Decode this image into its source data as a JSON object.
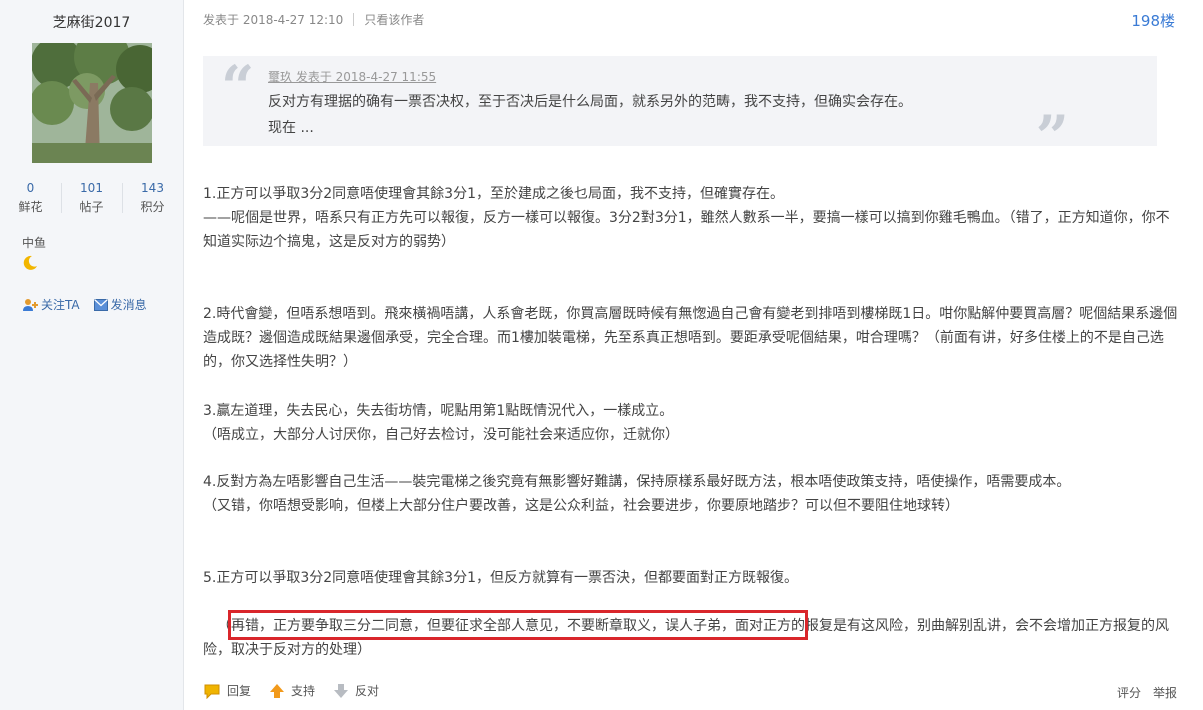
{
  "user": {
    "name": "芝麻街2017",
    "stats": [
      {
        "value": "0",
        "label": "鲜花"
      },
      {
        "value": "101",
        "label": "帖子"
      },
      {
        "value": "143",
        "label": "积分"
      }
    ],
    "rank": "中鱼",
    "follow_label": "关注TA",
    "message_label": "发消息"
  },
  "post": {
    "posted_at": "发表于 2018-4-27 12:10",
    "only_author": "只看该作者",
    "floor": "198楼",
    "quote": {
      "header": "璽玖 发表于 2018-4-27 11:55",
      "line1": "反对方有理据的确有一票否决权，至于否决后是什么局面，就系另外的范畴，我不支持，但确实会存在。",
      "line2": "现在 ..."
    },
    "body": {
      "p1a": "1.正方可以爭取3分2同意唔使理會其餘3分1，至於建成之後乜局面，我不支持，但確實存在。",
      "p1b": "——呢個是世界，唔系只有正方先可以報復，反方一樣可以報復。3分2對3分1，雖然人數系一半，要搞一樣可以搞到你雞毛鴨血。（错了，正方知道你，你不知道实际边个搞鬼，这是反对方的弱势）",
      "p2": "2.時代會變，但唔系想唔到。飛來橫禍唔講，人系會老既，你買高層既時候有無愡過自己會有變老到排唔到樓梯既1日。咁你點解仲要買高層？呢個結果系邊個造成既？邊個造成既結果邊個承受，完全合理。而1樓加裝電梯，先至系真正想唔到。要距承受呢個結果，咁合理嗎？（前面有讲，好多住楼上的不是自己选的，你又选择性失明？）",
      "p3a": "3.贏左道理，失去民心，失去街坊情，呢點用第1點既情況代入，一樣成立。",
      "p3b": "（唔成立，大部分人讨厌你，自己好去检讨，没可能社会来适应你，迁就你）",
      "p4a": "4.反對方為左唔影響自己生活——裝完電梯之後究竟有無影響好難講，保持原樣系最好既方法，根本唔使政策支持，唔使操作，唔需要成本。",
      "p4b": "（又错，你唔想受影响，但楼上大部分住户要改善，这是公众利益，社会要进步，你要原地踏步？可以但不要阻住地球转）",
      "p5": "5.正方可以爭取3分2同意唔使理會其餘3分1，但反方就算有一票否決，但都要面對正方既報復。",
      "p6": "（再错，正方要争取三分二同意，但要征求全部人意见，不要断章取义，误人子弟，面对正方的报复是有这风险，别曲解别乱讲，会不会增加正方报复的风险，取决于反对方的处理）"
    },
    "footer": {
      "reply": "回复",
      "support": "支持",
      "oppose": "反对",
      "rate": "评分",
      "report": "举报"
    }
  },
  "colors": {
    "link_blue": "#3a7bd5",
    "highlight_red": "#d9262b",
    "sidebar_bg": "#f4f6f9",
    "quote_bg": "#f3f4f7"
  }
}
